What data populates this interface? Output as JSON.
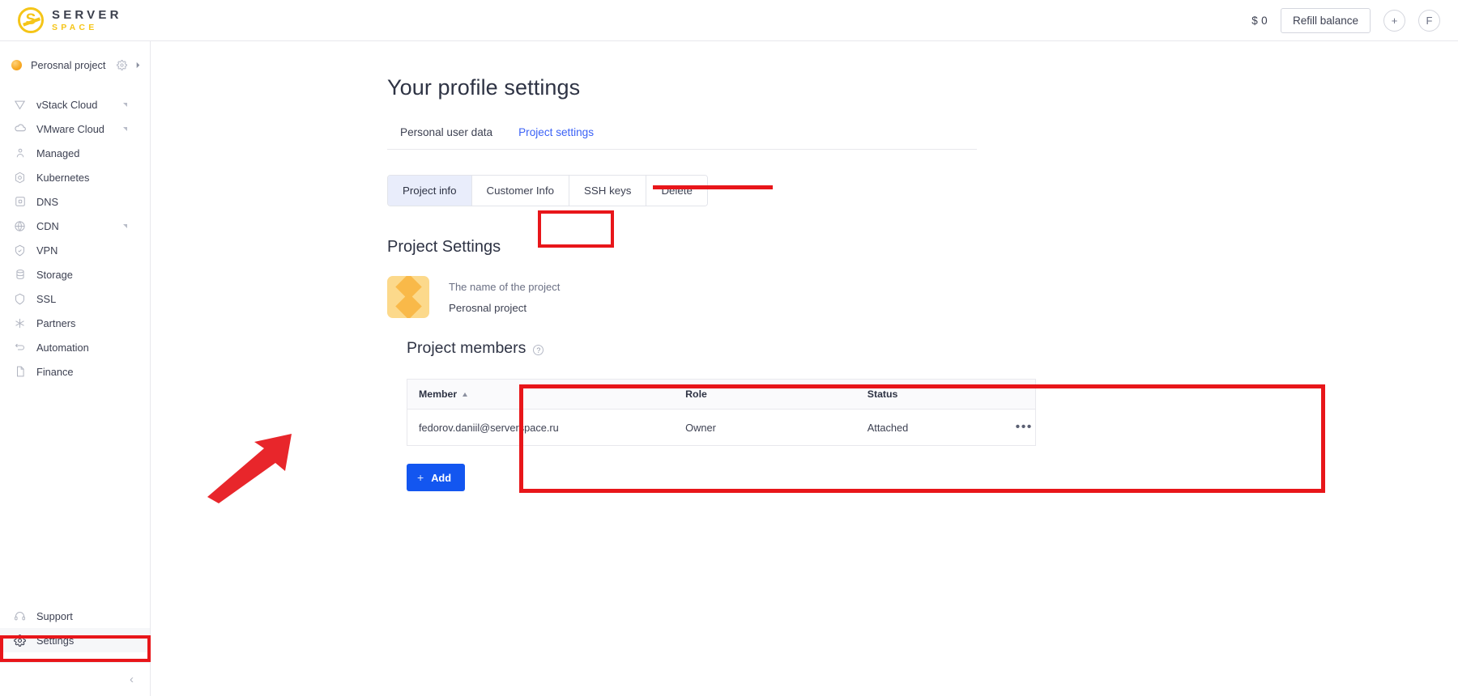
{
  "topbar": {
    "logo": {
      "mark_letter": "S",
      "line1": "SERVER",
      "line2": "SPACE",
      "mark_color": "#F5C518",
      "text_color": "#3b3f4c"
    },
    "balance": "$ 0",
    "refill_label": "Refill balance",
    "add_button_glyph": "+",
    "avatar_initial": "F"
  },
  "sidebar": {
    "project": {
      "name": "Perosnal project",
      "gear_icon": "gear-icon",
      "expand_icon": "chevron-right-icon",
      "dot_color": "#f7a823"
    },
    "items": [
      {
        "label": "vStack Cloud",
        "icon": "vstack-icon",
        "has_caret": true
      },
      {
        "label": "VMware Cloud",
        "icon": "cloud-icon",
        "has_caret": true
      },
      {
        "label": "Managed",
        "icon": "person-icon",
        "has_caret": false
      },
      {
        "label": "Kubernetes",
        "icon": "kubernetes-icon",
        "has_caret": false
      },
      {
        "label": "DNS",
        "icon": "dns-icon",
        "has_caret": false
      },
      {
        "label": "CDN",
        "icon": "globe-icon",
        "has_caret": true
      },
      {
        "label": "VPN",
        "icon": "vpn-shield-icon",
        "has_caret": false
      },
      {
        "label": "Storage",
        "icon": "database-icon",
        "has_caret": false
      },
      {
        "label": "SSL",
        "icon": "shield-icon",
        "has_caret": false
      },
      {
        "label": "Partners",
        "icon": "partners-icon",
        "has_caret": false
      },
      {
        "label": "Automation",
        "icon": "automation-icon",
        "has_caret": false
      },
      {
        "label": "Finance",
        "icon": "document-icon",
        "has_caret": false
      }
    ],
    "bottom_items": [
      {
        "label": "Support",
        "icon": "headset-icon",
        "active": false
      },
      {
        "label": "Settings",
        "icon": "gear-icon",
        "active": true
      }
    ],
    "collapse_glyph": "‹"
  },
  "main": {
    "page_title": "Your profile settings",
    "tabs_level1": [
      {
        "label": "Personal user data",
        "active": false
      },
      {
        "label": "Project settings",
        "active": true
      }
    ],
    "tabs_level2": [
      {
        "label": "Project info",
        "active": true
      },
      {
        "label": "Customer Info",
        "active": false
      },
      {
        "label": "SSH keys",
        "active": false
      },
      {
        "label": "Delete",
        "active": false
      }
    ],
    "project_settings": {
      "heading": "Project Settings",
      "avatar_icon": "diamond-avatar-icon",
      "name_label": "The name of the project",
      "name_value": "Perosnal project"
    },
    "members": {
      "title": "Project members",
      "help_icon": "question-mark-icon",
      "columns": [
        "Member",
        "Role",
        "Status",
        ""
      ],
      "sorted_column": "Member",
      "sort_direction": "asc",
      "rows": [
        {
          "member": "fedorov.daniil@serverspace.ru",
          "role": "Owner",
          "status": "Attached",
          "actions_glyph": "•••"
        }
      ],
      "add_label": "Add",
      "add_plus": "+",
      "add_color": "#1356f0"
    }
  },
  "annotations": {
    "highlight_color": "#e8161a",
    "items": [
      {
        "name": "settings-sidebar-highlight",
        "shape": "box"
      },
      {
        "name": "project-settings-tab-underline",
        "shape": "bar"
      },
      {
        "name": "project-info-tab-highlight",
        "shape": "box"
      },
      {
        "name": "project-members-highlight",
        "shape": "box"
      },
      {
        "name": "pointer-arrow",
        "shape": "arrow"
      }
    ]
  }
}
